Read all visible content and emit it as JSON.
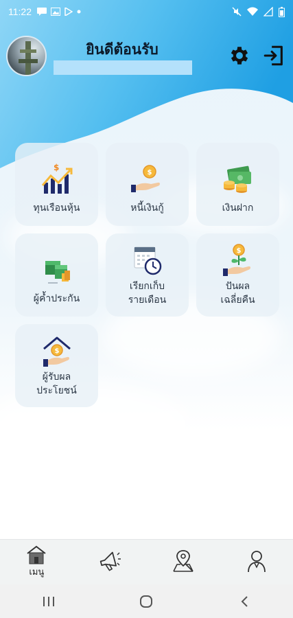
{
  "status_bar": {
    "time": "11:22",
    "left_icons": [
      "message-icon",
      "image-icon",
      "play-store-icon",
      "dot-icon"
    ],
    "right_icons": [
      "mute-icon",
      "wifi-icon",
      "signal-icon",
      "battery-icon"
    ]
  },
  "header": {
    "welcome_text": "ยินดีต้อนรับ",
    "user_name": "",
    "settings_icon": "gear-icon",
    "logout_icon": "logout-icon"
  },
  "menu": {
    "tiles": [
      {
        "label": "ทุนเรือนหุ้น",
        "icon": "stock-chart-icon"
      },
      {
        "label": "หนี้เงินกู้",
        "icon": "hand-coin-icon"
      },
      {
        "label": "เงินฝาก",
        "icon": "cash-stack-icon"
      },
      {
        "label": "ผู้ค้ำประกัน",
        "icon": "money-boxes-icon"
      },
      {
        "label_line1": "เรียกเก็บ",
        "label_line2": "รายเดือน",
        "icon": "calendar-clock-icon"
      },
      {
        "label_line1": "ปันผล",
        "label_line2": "เฉลี่ยคืน",
        "icon": "plant-coin-icon"
      },
      {
        "label_line1": "ผู้รับผล",
        "label_line2": "ประโยชน์",
        "icon": "house-hand-icon"
      }
    ]
  },
  "bottom_nav": {
    "items": [
      {
        "label": "เมนู",
        "icon": "home-icon",
        "active": true
      },
      {
        "label": "",
        "icon": "megaphone-icon"
      },
      {
        "label": "",
        "icon": "map-pin-icon"
      },
      {
        "label": "",
        "icon": "user-icon"
      }
    ]
  },
  "system_nav": {
    "items": [
      "recent-apps-icon",
      "home-circle-icon",
      "back-icon"
    ]
  },
  "colors": {
    "header_blue": "#2aa7e8",
    "name_bar": "#b4e1fb",
    "tile_bg": "#e8f0f6",
    "coin": "#f6b93b",
    "navy": "#1f2a6b"
  }
}
